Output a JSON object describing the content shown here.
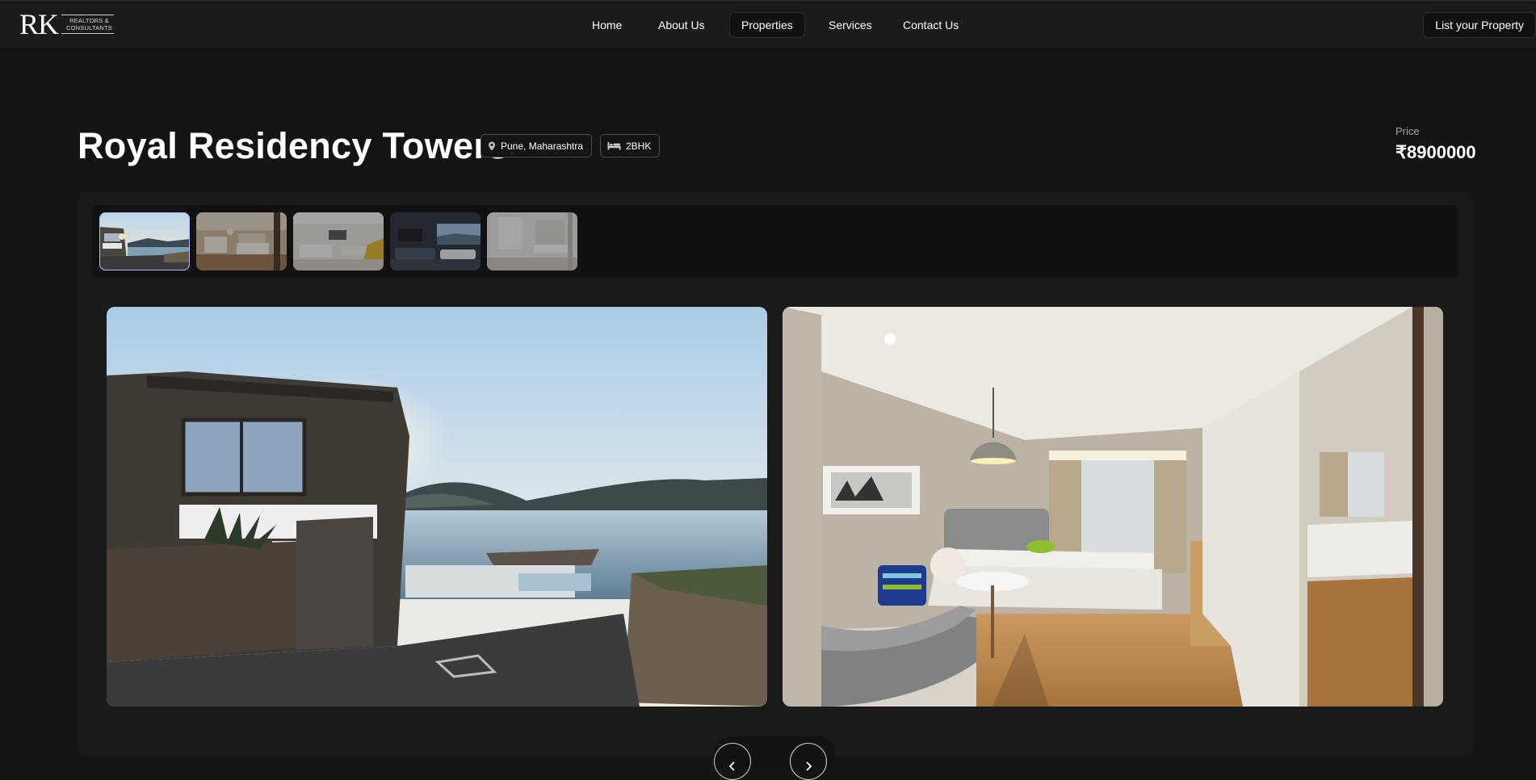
{
  "brand": {
    "mark": "RK",
    "tagline_line1": "REALTORS &",
    "tagline_line2": "CONSULTANTS"
  },
  "nav": {
    "items": [
      {
        "label": "Home",
        "active": false
      },
      {
        "label": "About Us",
        "active": false
      },
      {
        "label": "Properties",
        "active": true
      },
      {
        "label": "Services",
        "active": false
      },
      {
        "label": "Contact Us",
        "active": false
      }
    ],
    "cta_label": "List your Property"
  },
  "property": {
    "title": "Royal Residency Towers",
    "location": "Pune, Maharashtra",
    "bedrooms": "2BHK",
    "price_label": "Price",
    "price_value": "₹8900000"
  },
  "gallery": {
    "thumbnails": [
      {
        "name": "seaside-villa",
        "selected": true
      },
      {
        "name": "bedroom-suite",
        "selected": false
      },
      {
        "name": "living-room",
        "selected": false
      },
      {
        "name": "lounge-view",
        "selected": false
      },
      {
        "name": "bathroom",
        "selected": false
      }
    ],
    "slides": [
      {
        "name": "seaside-villa-exterior"
      },
      {
        "name": "hotel-style-bedroom"
      }
    ]
  },
  "icons": {
    "location": "map-pin-icon",
    "bed": "bed-icon",
    "prev": "chevron-left-icon",
    "next": "chevron-right-icon"
  },
  "colors": {
    "background": "#141414",
    "panel": "#1a1a1a",
    "selected_outline": "#b9b6ff"
  }
}
